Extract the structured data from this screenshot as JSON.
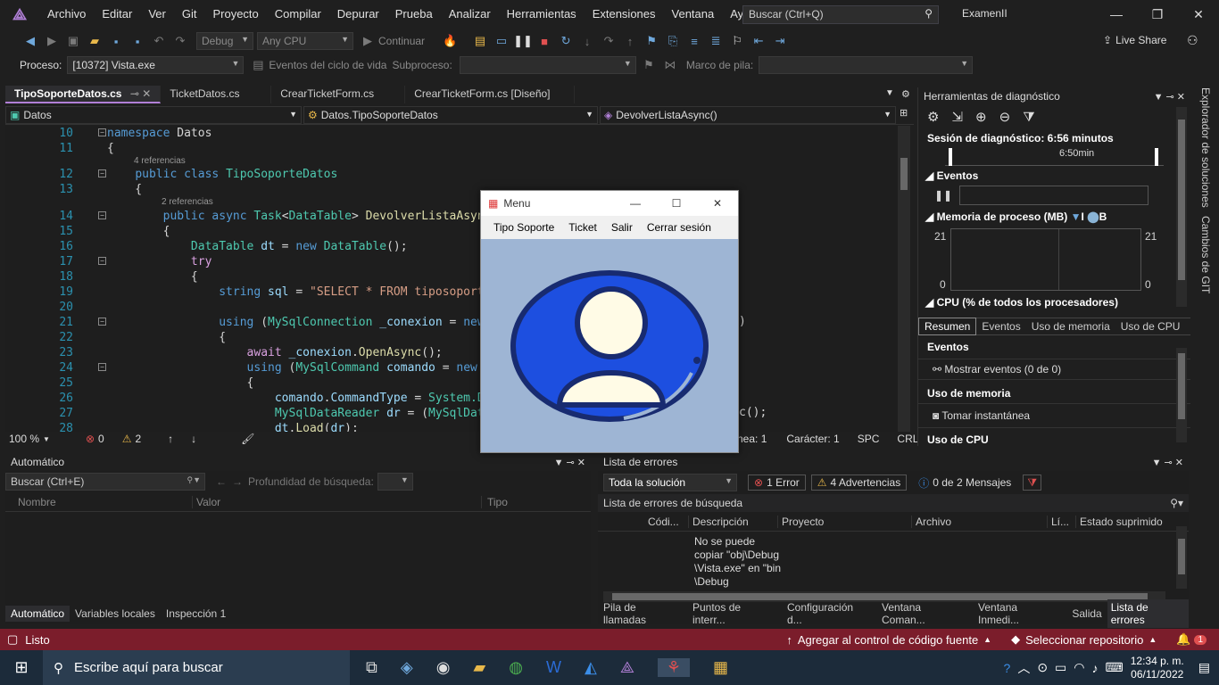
{
  "menubar": {
    "items": [
      "Archivo",
      "Editar",
      "Ver",
      "Git",
      "Proyecto",
      "Compilar",
      "Depurar",
      "Prueba",
      "Analizar",
      "Herramientas",
      "Extensiones",
      "Ventana",
      "Ayuda"
    ],
    "search_placeholder": "Buscar (Ctrl+Q)",
    "solution_name": "ExamenII"
  },
  "toolbar": {
    "config": "Debug",
    "platform": "Any CPU",
    "continue": "Continuar",
    "live_share": "Live Share"
  },
  "toolbar2": {
    "process_label": "Proceso:",
    "process_value": "[10372] Vista.exe",
    "lifecycle": "Eventos del ciclo de vida",
    "thread_label": "Subproceso:",
    "stack_label": "Marco de pila:"
  },
  "tabs": [
    "TipoSoporteDatos.cs",
    "TicketDatos.cs",
    "CrearTicketForm.cs",
    "CrearTicketForm.cs [Diseño]"
  ],
  "nav": {
    "project": "Datos",
    "class": "Datos.TipoSoporteDatos",
    "member": "DevolverListaAsync()"
  },
  "code": {
    "refs4": "4 referencias",
    "refs2": "2 referencias",
    "lines": [
      {
        "n": "10",
        "t": "namespace Datos"
      },
      {
        "n": "11",
        "t": "{"
      },
      {
        "n": "12",
        "t": "    public class TipoSoporteDatos"
      },
      {
        "n": "13",
        "t": "    {"
      },
      {
        "n": "14",
        "t": "        public async Task<DataTable> DevolverListaAsync"
      },
      {
        "n": "15",
        "t": "        {"
      },
      {
        "n": "16",
        "t": "            DataTable dt = new DataTable();"
      },
      {
        "n": "17",
        "t": "            try"
      },
      {
        "n": "18",
        "t": "            {"
      },
      {
        "n": "19",
        "t": "                string sql = \"SELECT * FROM tiposoporte"
      },
      {
        "n": "20",
        "t": ""
      },
      {
        "n": "21",
        "t": "                using (MySqlConnection _conexion = new"
      },
      {
        "n": "22",
        "t": "                {"
      },
      {
        "n": "23",
        "t": "                    await _conexion.OpenAsync();"
      },
      {
        "n": "24",
        "t": "                    using (MySqlCommand comando = new M"
      },
      {
        "n": "25",
        "t": "                    {"
      },
      {
        "n": "26",
        "t": "                        comando.CommandType = System.Da"
      },
      {
        "n": "27",
        "t": "                        MySqlDataReader dr = (MySqlData"
      },
      {
        "n": "28",
        "t": "                        dt.Load(dr);"
      }
    ],
    "behind_form": {
      "l21": ")",
      "l27": "c();"
    }
  },
  "editor_status": {
    "zoom": "100 %",
    "errors": "0",
    "warnings": "2",
    "line": "nea: 1",
    "char": "Carácter: 1",
    "spc": "SPC",
    "crlf": "CRLF"
  },
  "diagnostics": {
    "title": "Herramientas de diagnóstico",
    "session": "Sesión de diagnóstico: 6:56 minutos",
    "timeline": "6:50min",
    "events": "Eventos",
    "memory": "Memoria de proceso (MB)",
    "mem_max": "21",
    "mem_min": "0",
    "legend": [
      "I",
      "B"
    ],
    "cpu": "CPU (% de todos los procesadores)",
    "tabs": [
      "Resumen",
      "Eventos",
      "Uso de memoria",
      "Uso de CPU"
    ],
    "events_hdr": "Eventos",
    "show_events": "Mostrar eventos (0 de 0)",
    "mem_hdr": "Uso de memoria",
    "snapshot": "Tomar instantánea",
    "cpu_hdr": "Uso de CPU"
  },
  "side": {
    "solution_explorer": "Explorador de soluciones",
    "git_changes": "Cambios de GIT"
  },
  "autos": {
    "title": "Automático",
    "search": "Buscar (Ctrl+E)",
    "depth": "Profundidad de búsqueda:",
    "cols": [
      "Nombre",
      "Valor",
      "Tipo"
    ],
    "bottom_tabs": [
      "Automático",
      "Variables locales",
      "Inspección 1"
    ]
  },
  "errors": {
    "title": "Lista de errores",
    "scope": "Toda la solución",
    "err_count": "1 Error",
    "warn_count": "4 Advertencias",
    "msg_count": "0 de 2 Mensajes",
    "search": "Lista de errores de búsqueda",
    "cols": [
      "Códi...",
      "Descripción",
      "Proyecto",
      "Archivo",
      "Lí...",
      "Estado suprimido"
    ],
    "desc_lines": [
      "No se puede",
      "copiar \"obj\\Debug",
      "\\Vista.exe\" en \"bin",
      "\\Debug"
    ],
    "bottom_tabs": [
      "Pila de llamadas",
      "Puntos de interr...",
      "Configuración d...",
      "Ventana Coman...",
      "Ventana Inmedi...",
      "Salida",
      "Lista de errores"
    ]
  },
  "statusbar": {
    "ready": "Listo",
    "add_source": "Agregar al control de código fuente",
    "repo": "Seleccionar repositorio",
    "notif": "1"
  },
  "winform": {
    "title": "Menu",
    "menu": [
      "Tipo Soporte",
      "Ticket",
      "Salir",
      "Cerrar sesión"
    ]
  },
  "taskbar": {
    "search": "Escribe aquí para buscar",
    "time": "12:34 p. m.",
    "date": "06/11/2022"
  }
}
